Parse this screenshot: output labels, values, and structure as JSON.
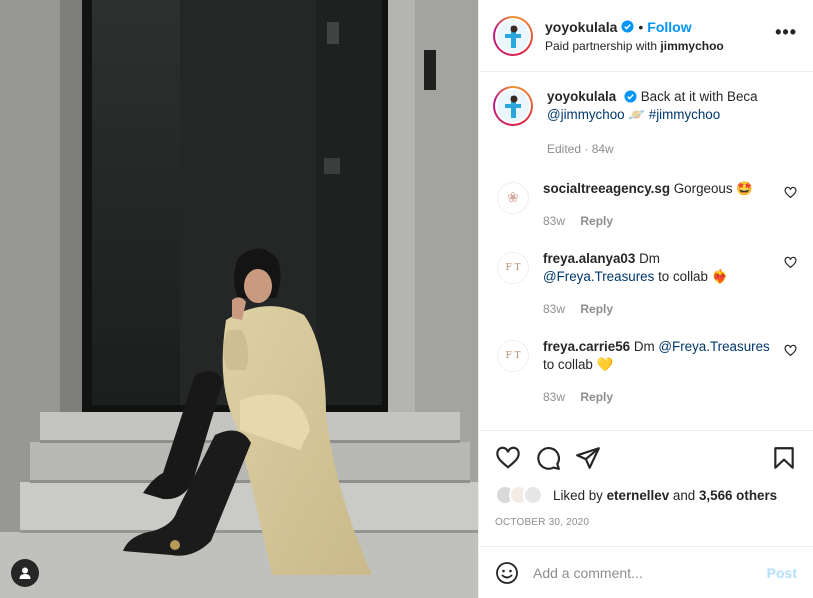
{
  "post": {
    "username": "yoyokulala",
    "follow_label": "Follow",
    "separator": "•",
    "partnership_prefix": "Paid partnership with",
    "partner": "jimmychoo",
    "more_label": "•••",
    "caption": {
      "username": "yoyokulala",
      "text": "Back at it with Beca",
      "mention": "@jimmychoo",
      "emoji": "🪐",
      "hashtag": "#jimmychoo",
      "meta": "Edited · 84w"
    },
    "comments": [
      {
        "username": "socialtreeagency.sg",
        "text": "Gorgeous",
        "mention": "",
        "text_after": "",
        "emoji": "🤩",
        "avatar": "❀",
        "age": "83w",
        "reply": "Reply"
      },
      {
        "username": "freya.alanya03",
        "text": "Dm",
        "mention": "@Freya.Treasures",
        "text_after": "to collab",
        "emoji": "❤️‍🔥",
        "avatar": "F T",
        "age": "83w",
        "reply": "Reply"
      },
      {
        "username": "freya.carrie56",
        "text": "Dm",
        "mention": "@Freya.Treasures",
        "text_after": "to collab",
        "emoji": "💛",
        "avatar": "F T",
        "age": "83w",
        "reply": "Reply"
      }
    ],
    "likes": {
      "prefix": "Liked by",
      "user": "eternellev",
      "joiner": "and",
      "count": "3,566 others"
    },
    "date": "OCTOBER 30, 2020",
    "comment_placeholder": "Add a comment...",
    "post_label": "Post"
  },
  "icons": [
    "heart-icon",
    "comment-icon",
    "share-icon",
    "bookmark-icon",
    "emoji-icon",
    "more-icon",
    "verified-icon",
    "user-tag-icon"
  ],
  "colors": {
    "link": "#00376b",
    "follow": "#0095f6",
    "post_disabled": "#b2dffc",
    "meta": "#8e8e8e"
  }
}
